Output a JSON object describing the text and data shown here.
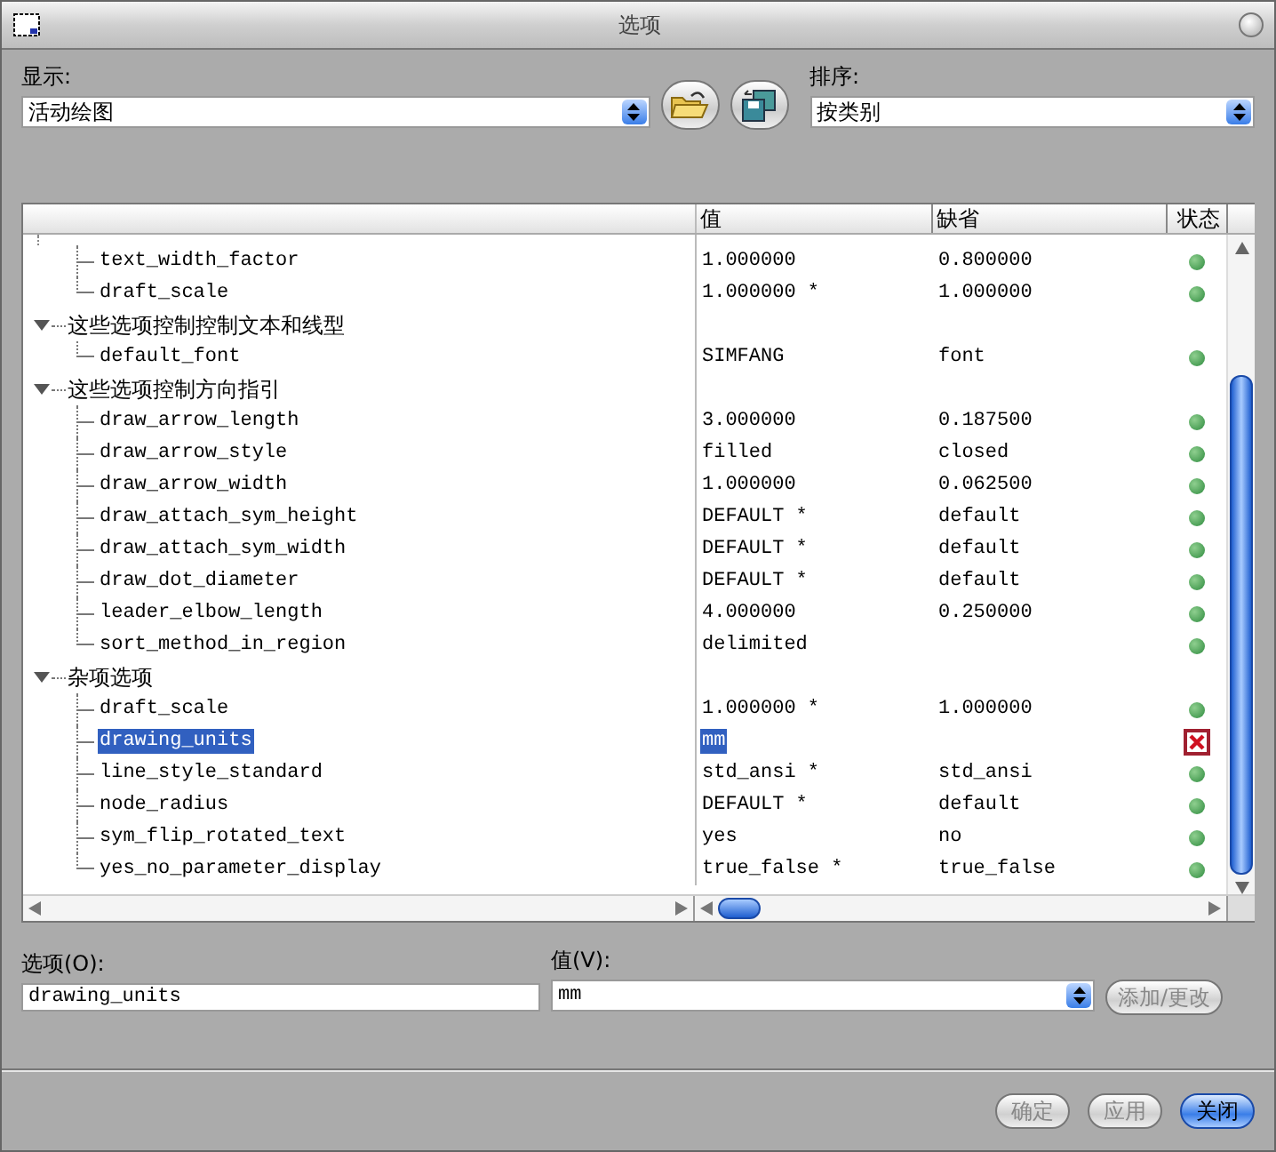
{
  "window": {
    "title": "选项"
  },
  "display": {
    "label": "显示:",
    "value": "活动绘图"
  },
  "sort": {
    "label": "排序:",
    "value": "按类别"
  },
  "table": {
    "columns": [
      "值",
      "缺省",
      "状态"
    ],
    "tree": [
      {
        "children": [
          {
            "name": "text_width_factor",
            "value": "1.000000",
            "default": "0.800000",
            "error": false,
            "selected": false
          },
          {
            "name": "draft_scale",
            "value": "1.000000 *",
            "default": "1.000000",
            "error": false,
            "selected": false
          }
        ]
      },
      {
        "label": "这些选项控制控制文本和线型",
        "expanded": true,
        "children": [
          {
            "name": "default_font",
            "value": "SIMFANG",
            "default": "font",
            "error": false,
            "selected": false
          }
        ]
      },
      {
        "label": "这些选项控制方向指引",
        "expanded": true,
        "children": [
          {
            "name": "draw_arrow_length",
            "value": "3.000000",
            "default": "0.187500",
            "error": false,
            "selected": false
          },
          {
            "name": "draw_arrow_style",
            "value": "filled",
            "default": "closed",
            "error": false,
            "selected": false
          },
          {
            "name": "draw_arrow_width",
            "value": "1.000000",
            "default": "0.062500",
            "error": false,
            "selected": false
          },
          {
            "name": "draw_attach_sym_height",
            "value": "DEFAULT *",
            "default": "default",
            "error": false,
            "selected": false
          },
          {
            "name": "draw_attach_sym_width",
            "value": "DEFAULT *",
            "default": "default",
            "error": false,
            "selected": false
          },
          {
            "name": "draw_dot_diameter",
            "value": "DEFAULT *",
            "default": "default",
            "error": false,
            "selected": false
          },
          {
            "name": "leader_elbow_length",
            "value": "4.000000",
            "default": "0.250000",
            "error": false,
            "selected": false
          },
          {
            "name": "sort_method_in_region",
            "value": "delimited",
            "error": false,
            "selected": false
          }
        ]
      },
      {
        "label": "杂项选项",
        "expanded": true,
        "children": [
          {
            "name": "draft_scale",
            "value": "1.000000 *",
            "default": "1.000000",
            "error": false,
            "selected": false
          },
          {
            "name": "drawing_units",
            "value": "mm",
            "error": true,
            "selected": true
          },
          {
            "name": "line_style_standard",
            "value": "std_ansi *",
            "default": "std_ansi",
            "error": false,
            "selected": false
          },
          {
            "name": "node_radius",
            "value": "DEFAULT *",
            "default": "default",
            "error": false,
            "selected": false
          },
          {
            "name": "sym_flip_rotated_text",
            "value": "yes",
            "default": "no",
            "error": false,
            "selected": false
          },
          {
            "name": "yes_no_parameter_display",
            "value": "true_false *",
            "default": "true_false",
            "error": false,
            "selected": false
          }
        ]
      }
    ]
  },
  "option_field": {
    "label": "选项(O):",
    "value": "drawing_units"
  },
  "value_field": {
    "label": "值(V):",
    "value": "mm"
  },
  "add_button": {
    "label": "添加/更改",
    "disabled": true
  },
  "buttons": [
    {
      "label": "确定",
      "disabled": true,
      "default": false
    },
    {
      "label": "应用",
      "disabled": true,
      "default": false
    },
    {
      "label": "关闭",
      "disabled": false,
      "default": true
    }
  ]
}
